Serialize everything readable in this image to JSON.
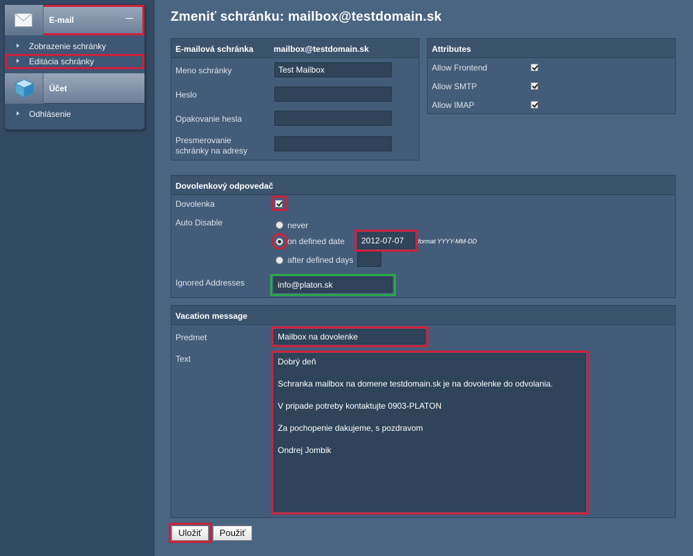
{
  "sidebar": {
    "email_section": {
      "title": "E-mail"
    },
    "items": [
      {
        "label": "Zobrazenie schránky"
      },
      {
        "label": "Editácia schránky"
      }
    ],
    "account_section": {
      "title": "Účet"
    },
    "logout": {
      "label": "Odhlásenie"
    }
  },
  "page": {
    "title": "Zmeniť schránku: mailbox@testdomain.sk"
  },
  "mailbox_panel": {
    "header_label": "E-mailová schránka",
    "header_value": "mailbox@testdomain.sk",
    "name_label": "Meno schránky",
    "name_value": "Test Mailbox",
    "password_label": "Heslo",
    "password_value": "",
    "password_repeat_label": "Opakovanie hesla",
    "password_repeat_value": "",
    "redirect_label_line1": "Presmerovanie",
    "redirect_label_line2": "schránky na adresy",
    "redirect_value": ""
  },
  "attributes_panel": {
    "title": "Attributes",
    "items": [
      {
        "label": "Allow Frontend",
        "checked": true
      },
      {
        "label": "Allow SMTP",
        "checked": true
      },
      {
        "label": "Allow IMAP",
        "checked": true
      }
    ]
  },
  "vacation_panel": {
    "title": "Dovolenkový odpovedač",
    "vacation_label": "Dovolenka",
    "vacation_checked": true,
    "auto_disable_label": "Auto Disable",
    "options": {
      "never": "never",
      "on_date": "on defined date",
      "after_days": "after defined days"
    },
    "selected_option": "on_date",
    "date_value": "2012-07-07",
    "format_note": "format YYYY-MM-DD",
    "days_value": "",
    "ignored_label": "Ignored Addresses",
    "ignored_value": "info@platon.sk"
  },
  "message_panel": {
    "title": "Vacation message",
    "subject_label": "Predmet",
    "subject_value": "Mailbox na dovolenke",
    "text_label": "Text",
    "text_lines": [
      "Dobrý deň",
      "Schranka mailbox na domene testdomain.sk je na dovolenke do odvolania.",
      "V pripade potreby kontaktujte 0903-PLATON",
      "Za pochopenie dakujeme, s pozdravom",
      "Ondrej Jombik"
    ]
  },
  "buttons": {
    "save": "Uložiť",
    "apply": "Použiť"
  },
  "colors": {
    "highlight_red": "#d0203a",
    "highlight_green": "#2aa84a"
  }
}
